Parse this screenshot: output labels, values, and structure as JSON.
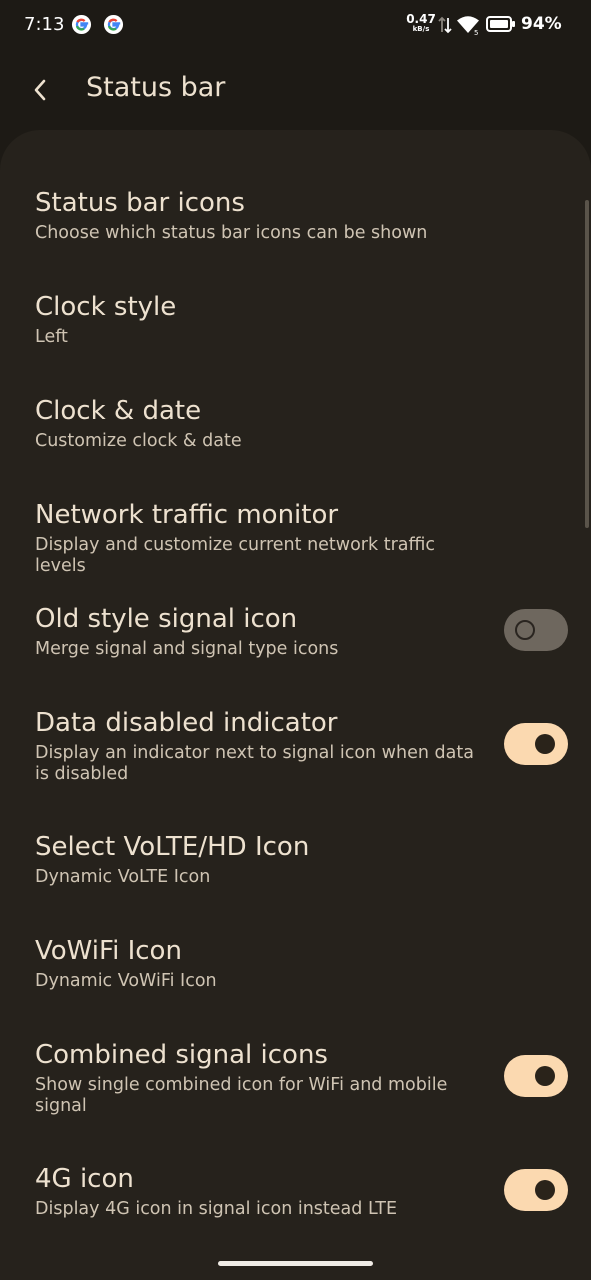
{
  "status_bar": {
    "time": "7:13",
    "notification_icons": [
      "google-icon",
      "google-icon"
    ],
    "net_speed_value": "0.47",
    "net_speed_unit": "kB/s",
    "battery_percent": "94%"
  },
  "app_bar": {
    "title": "Status bar"
  },
  "settings": [
    {
      "title": "Status bar icons",
      "summary": "Choose which status bar icons can be shown"
    },
    {
      "title": "Clock style",
      "summary": "Left"
    },
    {
      "title": "Clock & date",
      "summary": "Customize clock & date"
    },
    {
      "title": "Network traffic monitor",
      "summary": "Display and customize current network traffic levels"
    },
    {
      "title": "Old style signal icon",
      "summary": "Merge signal and signal type icons",
      "toggle": false
    },
    {
      "title": "Data disabled indicator",
      "summary": "Display an indicator next to signal icon when data is disabled",
      "toggle": true
    },
    {
      "title": "Select VoLTE/HD Icon",
      "summary": "Dynamic VoLTE Icon"
    },
    {
      "title": "VoWiFi Icon",
      "summary": "Dynamic VoWiFi Icon"
    },
    {
      "title": "Combined signal icons",
      "summary": "Show single combined icon for WiFi and mobile signal",
      "toggle": true
    },
    {
      "title": "4G icon",
      "summary": "Display 4G icon in signal icon instead LTE",
      "toggle": true
    }
  ],
  "colors": {
    "background": "#1d1a15",
    "sheet": "#26221c",
    "toggle_on": "#fbd9b0",
    "toggle_off": "#6e675e"
  }
}
